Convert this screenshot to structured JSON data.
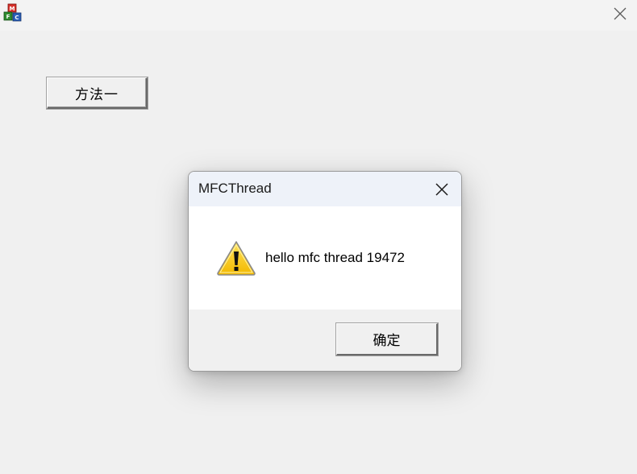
{
  "window": {
    "app_icon": "mfc-app-icon",
    "close_icon": "close-icon"
  },
  "main": {
    "method_button_label": "方法一"
  },
  "dialog": {
    "title": "MFCThread",
    "message": "hello mfc thread 19472",
    "icon": "warning-icon",
    "ok_label": "确定",
    "close_icon": "close-icon"
  },
  "colors": {
    "window_bg": "#f0f0f0",
    "dialog_title_bg": "#eef2f9",
    "dialog_body_bg": "#ffffff",
    "warning_yellow": "#f5c400"
  }
}
